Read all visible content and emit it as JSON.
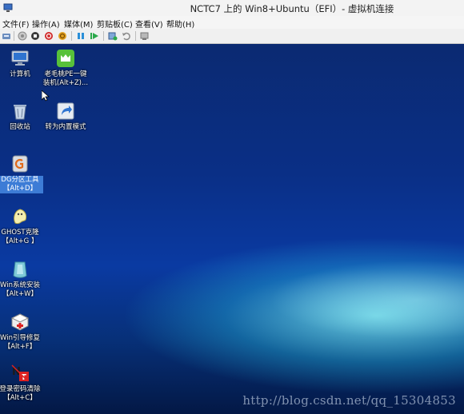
{
  "window": {
    "title": "NCTC7 上的 Win8+Ubuntu（EFI）- 虚拟机连接"
  },
  "menu": {
    "items": [
      {
        "label": "文件(F)"
      },
      {
        "label": "操作(A)"
      },
      {
        "label": "媒体(M)"
      },
      {
        "label": "剪贴板(C)"
      },
      {
        "label": "查看(V)"
      },
      {
        "label": "帮助(H)"
      }
    ]
  },
  "toolbar": {
    "icons": [
      "ctrl-alt-del-icon",
      "start-icon",
      "turn-off-icon",
      "shutdown-icon",
      "save-icon",
      "pause-icon",
      "resume-icon",
      "checkpoint-icon",
      "revert-icon",
      "enhanced-session-icon"
    ]
  },
  "desktop": {
    "icons": [
      {
        "line1": "计算机",
        "line2": ""
      },
      {
        "line1": "老毛桃PE一键",
        "line2": "装机(Alt+Z)..."
      },
      {
        "line1": "回收站",
        "line2": ""
      },
      {
        "line1": "转为内置模式",
        "line2": ""
      },
      {
        "line1": "DG分区工具",
        "line2": "【Alt+D】"
      },
      {
        "line1": "GHOST克隆",
        "line2": "【Alt+G 】"
      },
      {
        "line1": "Win系统安装",
        "line2": "【Alt+W】"
      },
      {
        "line1": "Win引导修复",
        "line2": "【Alt+F】"
      },
      {
        "line1": "登录密码清除",
        "line2": "【Alt+C】"
      }
    ],
    "watermark": "http://blog.csdn.net/qq_15304853"
  }
}
